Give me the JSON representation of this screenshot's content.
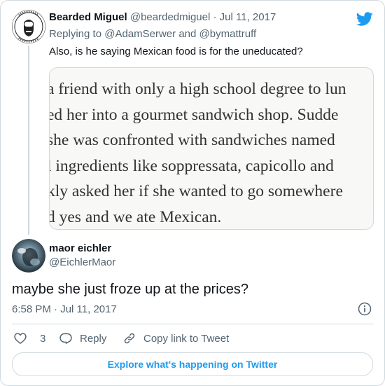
{
  "parent": {
    "name": "Bearded Miguel",
    "handle": "@beardedmiguel",
    "separator": " · ",
    "date": "Jul 11, 2017",
    "replying_prefix": "Replying to ",
    "replying_to_1": "@AdamSerwer",
    "replying_and": " and ",
    "replying_to_2": "@bymattruff",
    "text": "Also, is he saying Mexican food is for the uneducated?",
    "image_lines": [
      "a friend with only a high school degree to lun",
      "ed her into a gourmet sandwich shop. Sudde",
      " she was confronted with sandwiches named",
      "l ingredients like soppressata, capicollo and",
      "kly asked her if she wanted to go somewhere",
      "d yes and we ate Mexican."
    ]
  },
  "tweet": {
    "name": "maor eichler",
    "handle": "@EichlerMaor",
    "text": "maybe she just froze up at the prices?",
    "timestamp": "6:58 PM · Jul 11, 2017"
  },
  "actions": {
    "like_count": "3",
    "reply_label": "Reply",
    "copy_label": "Copy link to Tweet"
  },
  "explore_label": "Explore what's happening on Twitter",
  "colors": {
    "accent": "#1d9bf0",
    "muted": "#536471",
    "border": "#cfd9de"
  }
}
